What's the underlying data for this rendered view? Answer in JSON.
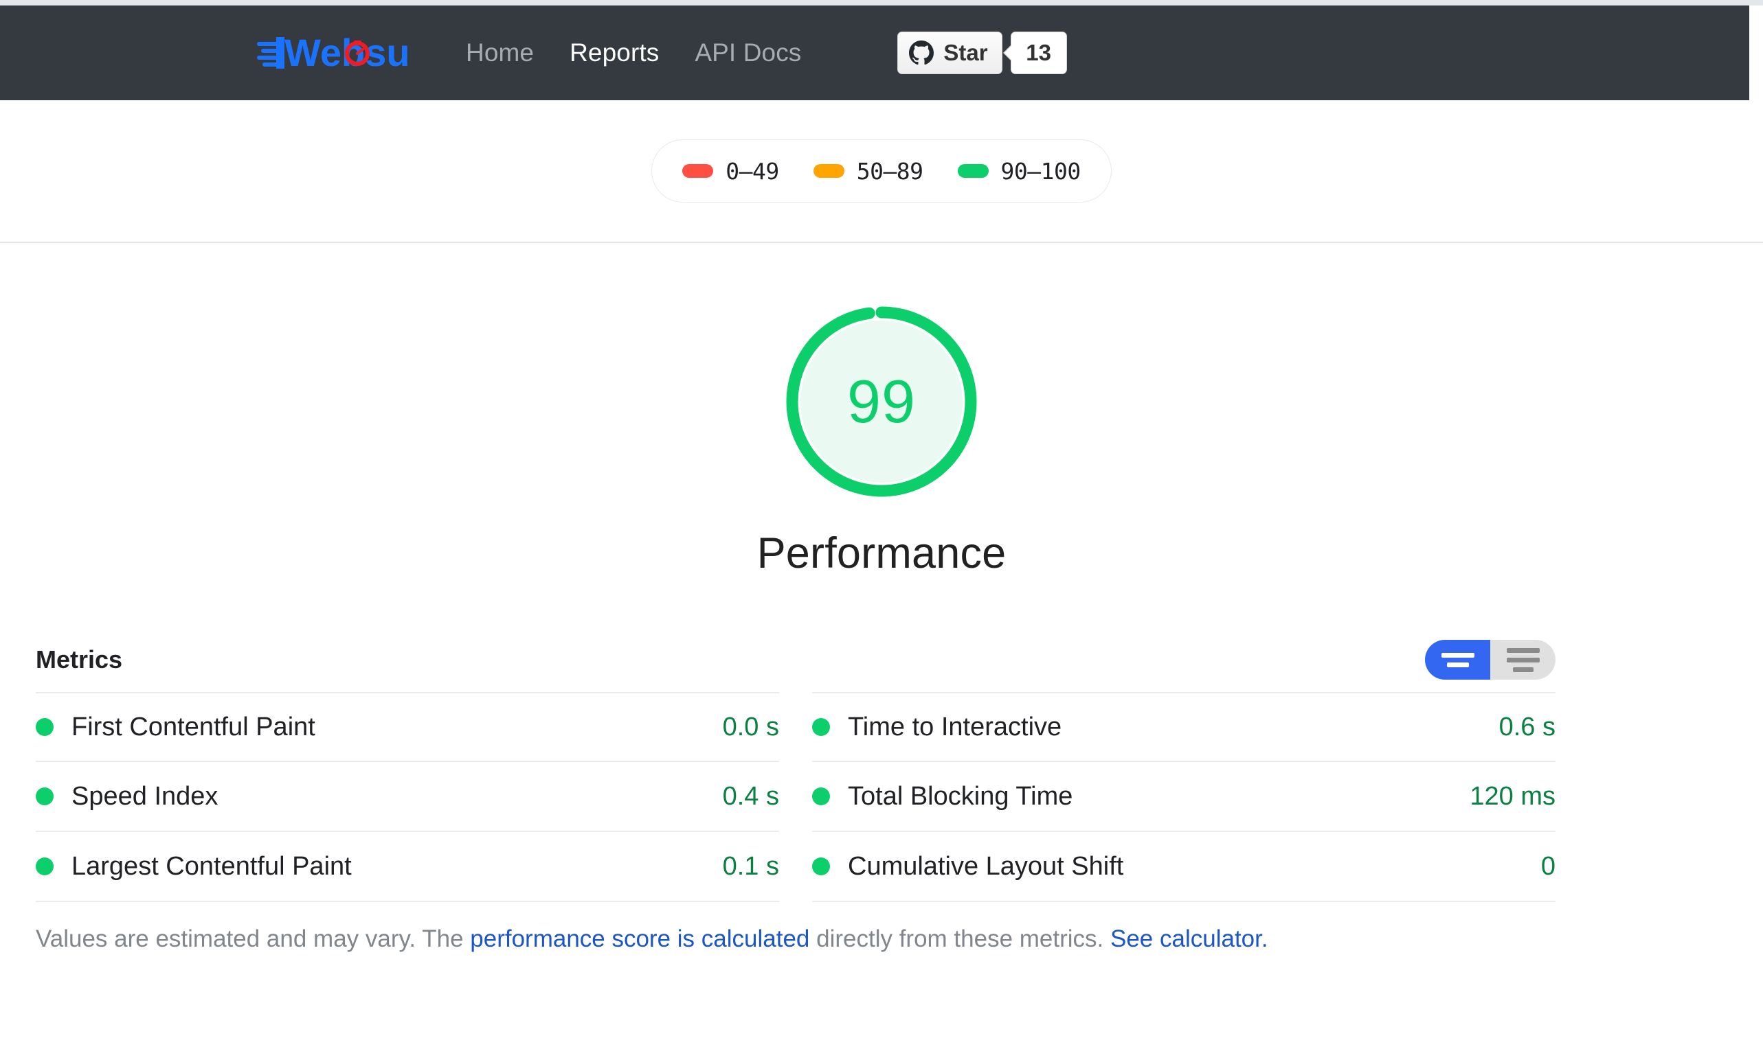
{
  "navbar": {
    "brand": {
      "name": "Websu",
      "logo_icon": "websu-speed-logo",
      "text_color": "#1a73ff",
      "accent_color": "#ee1c25"
    },
    "links": [
      {
        "label": "Home",
        "active": false
      },
      {
        "label": "Reports",
        "active": true
      },
      {
        "label": "API Docs",
        "active": false
      }
    ],
    "github": {
      "icon": "github-octocat-icon",
      "star_label": "Star",
      "count": "13"
    },
    "background_color": "#343a40"
  },
  "legend": {
    "items": [
      {
        "label": "0–49",
        "color": "#ff4e42"
      },
      {
        "label": "50–89",
        "color": "#ffa400"
      },
      {
        "label": "90–100",
        "color": "#0cce6b"
      }
    ]
  },
  "gauge": {
    "score": "99",
    "score_number": 99,
    "category": "Performance",
    "color": "#0cce6b",
    "fill_color": "#eaf9f1"
  },
  "metrics": {
    "title": "Metrics",
    "toggle": {
      "simple_view_icon": "simple-view-icon",
      "detailed_view_icon": "detailed-view-icon",
      "active": "simple",
      "active_color": "#3367f2",
      "inactive_color": "#e0e0e0"
    },
    "left_column": [
      {
        "label": "First Contentful Paint",
        "value": "0.0 s",
        "status": "pass",
        "dot_color": "#0cce6b"
      },
      {
        "label": "Speed Index",
        "value": "0.4 s",
        "status": "pass",
        "dot_color": "#0cce6b"
      },
      {
        "label": "Largest Contentful Paint",
        "value": "0.1 s",
        "status": "pass",
        "dot_color": "#0cce6b"
      }
    ],
    "right_column": [
      {
        "label": "Time to Interactive",
        "value": "0.6 s",
        "status": "pass",
        "dot_color": "#0cce6b"
      },
      {
        "label": "Total Blocking Time",
        "value": "120 ms",
        "status": "pass",
        "dot_color": "#0cce6b"
      },
      {
        "label": "Cumulative Layout Shift",
        "value": "0",
        "status": "pass",
        "dot_color": "#0cce6b"
      }
    ],
    "footer": {
      "text_1": "Values are estimated and may vary. The ",
      "link_1": "performance score is calculated",
      "text_2": " directly from these metrics. ",
      "link_2": "See calculator.",
      "link_color": "#1a56c8"
    }
  }
}
